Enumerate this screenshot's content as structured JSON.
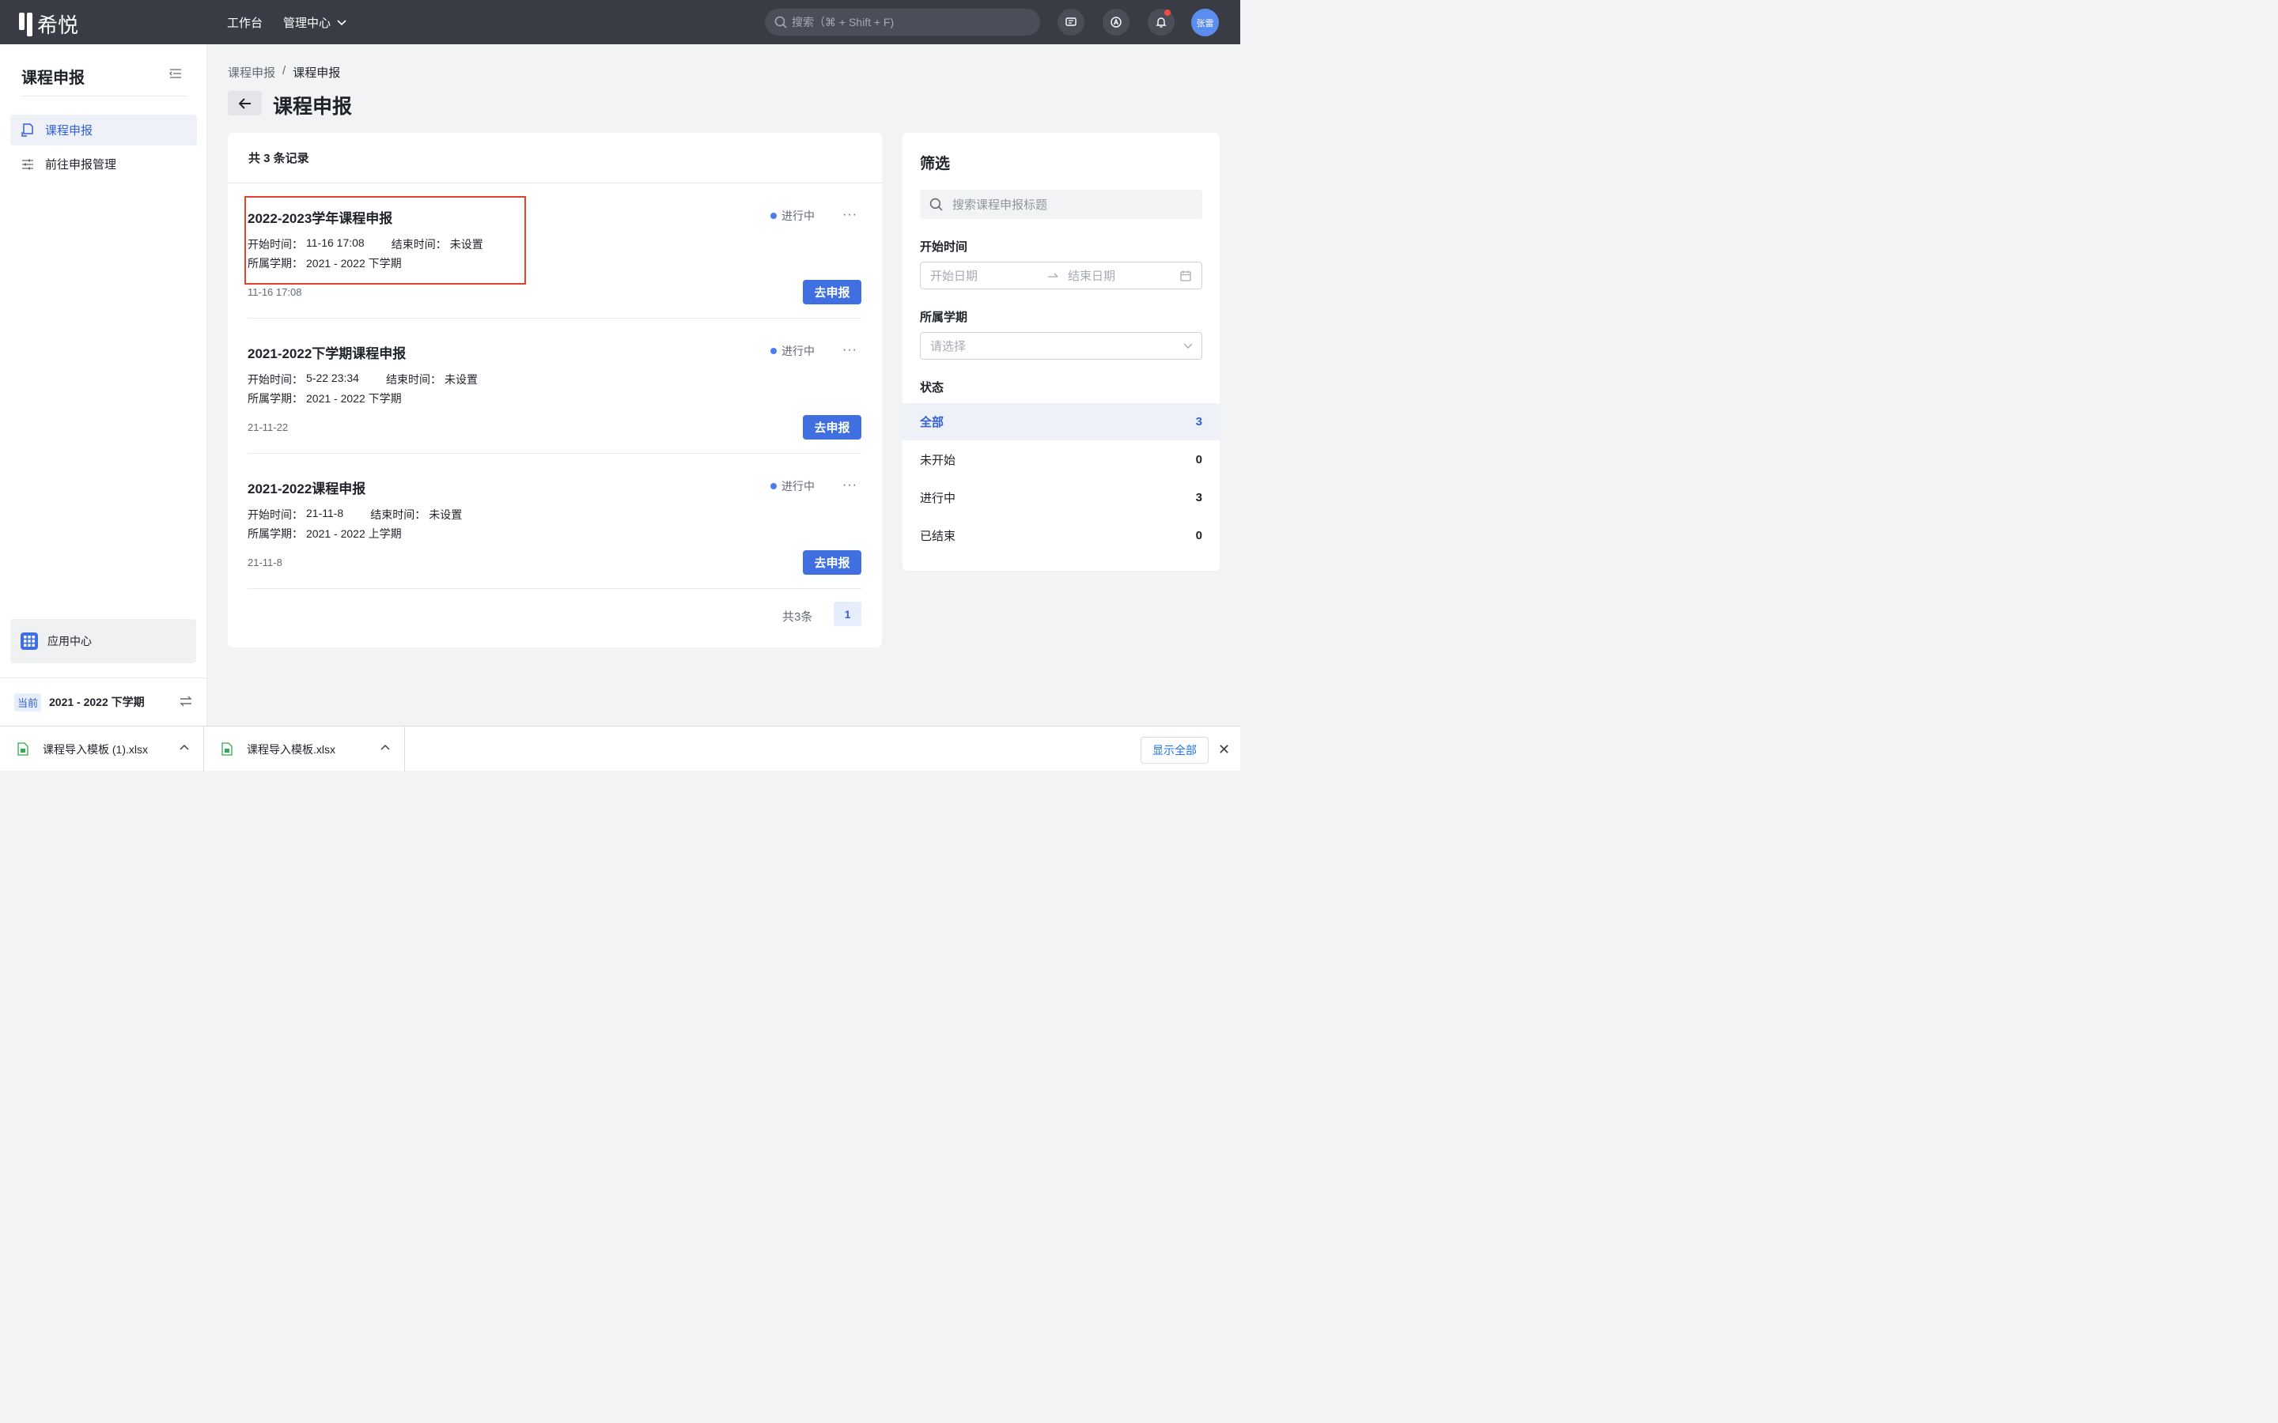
{
  "header": {
    "logo_text": "希悦",
    "nav": [
      {
        "label": "工作台"
      },
      {
        "label": "管理中心"
      }
    ],
    "search_placeholder": "搜索（⌘ + Shift + F)",
    "avatar_text": "张雷"
  },
  "sidebar": {
    "title": "课程申报",
    "items": [
      {
        "label": "课程申报"
      },
      {
        "label": "前往申报管理"
      }
    ],
    "app_center_label": "应用中心",
    "term_tag": "当前",
    "term_value": "2021 - 2022 下学期"
  },
  "main": {
    "breadcrumb": [
      "课程申报",
      "/",
      "课程申报"
    ],
    "title": "课程申报",
    "record_count_text": "共 3 条记录",
    "records": [
      {
        "title": "2022-2023学年课程申报",
        "start_label": "开始时间：",
        "start_value": "11-16 17:08",
        "end_label": "结束时间：",
        "end_value": "未设置",
        "term_label": "所属学期：",
        "term_value": "2021 - 2022 下学期",
        "date": "11-16 17:08",
        "status": "进行中",
        "action": "去申报"
      },
      {
        "title": "2021-2022下学期课程申报",
        "start_label": "开始时间：",
        "start_value": "5-22 23:34",
        "end_label": "结束时间：",
        "end_value": "未设置",
        "term_label": "所属学期：",
        "term_value": "2021 - 2022 下学期",
        "date": "21-11-22",
        "status": "进行中",
        "action": "去申报"
      },
      {
        "title": "2021-2022课程申报",
        "start_label": "开始时间：",
        "start_value": "21-11-8",
        "end_label": "结束时间：",
        "end_value": "未设置",
        "term_label": "所属学期：",
        "term_value": "2021 - 2022 上学期",
        "date": "21-11-8",
        "status": "进行中",
        "action": "去申报"
      }
    ],
    "pager_total": "共3条",
    "pager_page": "1"
  },
  "filter": {
    "title": "筛选",
    "search_placeholder": "搜索课程申报标题",
    "start_time_label": "开始时间",
    "start_date_placeholder": "开始日期",
    "end_date_placeholder": "结束日期",
    "term_label": "所属学期",
    "term_placeholder": "请选择",
    "status_label": "状态",
    "statuses": [
      {
        "label": "全部",
        "count": "3"
      },
      {
        "label": "未开始",
        "count": "0"
      },
      {
        "label": "进行中",
        "count": "3"
      },
      {
        "label": "已结束",
        "count": "0"
      }
    ]
  },
  "downloads": {
    "files": [
      {
        "name": "课程导入模板 (1).xlsx"
      },
      {
        "name": "课程导入模板.xlsx"
      }
    ],
    "show_all": "显示全部",
    "close": "✕"
  },
  "colors": {
    "accent": "#3f6fe0",
    "topbar": "#393c45",
    "status_dot": "#4e7cf0",
    "highlight_border": "#e5402b"
  }
}
